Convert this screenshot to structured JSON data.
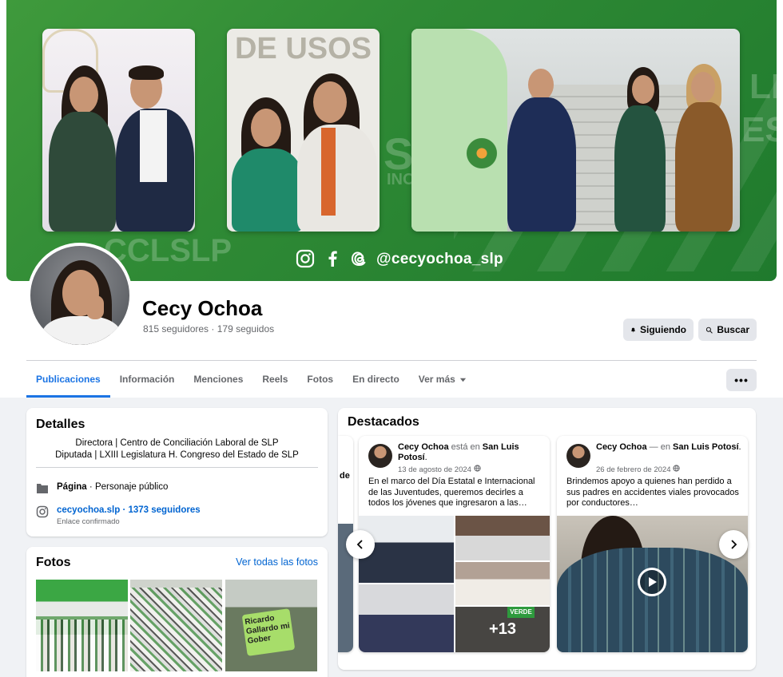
{
  "cover": {
    "handle": "@cecyochoa_slp",
    "social_icons": [
      "instagram-icon",
      "facebook-icon",
      "threads-icon"
    ],
    "background_text": [
      "DE USOS",
      "CCLSLP",
      "LL",
      "ESTADO",
      "SI",
      "INOS"
    ],
    "green": "#2f8a35"
  },
  "profile": {
    "name": "Cecy Ochoa",
    "stats": "815 seguidores · 179 seguidos"
  },
  "actions": {
    "following": "Siguiendo",
    "search": "Buscar",
    "more": "•••"
  },
  "tabs": [
    {
      "label": "Publicaciones",
      "active": true
    },
    {
      "label": "Información"
    },
    {
      "label": "Menciones"
    },
    {
      "label": "Reels"
    },
    {
      "label": "Fotos"
    },
    {
      "label": "En directo"
    },
    {
      "label": "Ver más"
    }
  ],
  "details": {
    "title": "Detalles",
    "bio_line1": "Directora | Centro de Conciliación Laboral de SLP",
    "bio_line2": "Diputada | LXIII Legislatura H. Congreso del Estado de SLP",
    "page_label": "Página",
    "page_category": " · Personaje público",
    "instagram": "cecyochoa.slp · 1373 seguidores",
    "instagram_sub": "Enlace confirmado"
  },
  "photos": {
    "title": "Fotos",
    "see_all": "Ver todas las fotos",
    "sign_text": "Ricardo Gallardo mi Gober"
  },
  "highlights": {
    "title": "Destacados",
    "prev_peek_text": "de",
    "posts": [
      {
        "author": "Cecy Ochoa",
        "connector": " está en ",
        "place": "San Luis Potosí",
        "date": "13 de agosto de 2024",
        "text": "En el marco del Día Estatal e Internacional de las Juventudes, queremos decirles a todos los jóvenes que ingresaron a las…",
        "more_count": "+13",
        "badge": "VERDE"
      },
      {
        "author": "Cecy Ochoa",
        "connector": " — en ",
        "place": "San Luis Potosí",
        "date": "26 de febrero de 2024",
        "text": "Brindemos apoyo a quienes han perdido a sus padres en accidentes viales provocados por conductores…"
      }
    ]
  },
  "colors": {
    "accent": "#1b74e4",
    "link": "#0064d1",
    "muted": "#65676b",
    "button_bg": "#e4e6eb"
  }
}
